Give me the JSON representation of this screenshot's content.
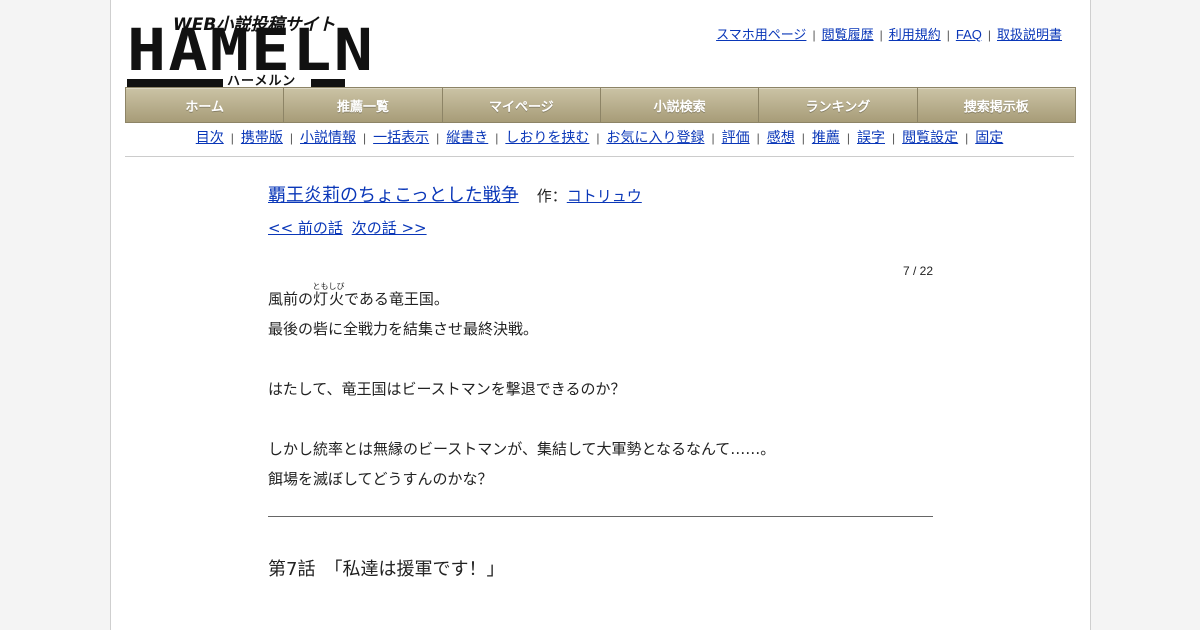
{
  "logo": {
    "tagline": "WEB小説投稿サイト",
    "wordmark": "HAMELN",
    "kana": "ハーメルン"
  },
  "top_links": [
    "スマホ用ページ",
    "閲覧履歴",
    "利用規約",
    "FAQ",
    "取扱説明書"
  ],
  "nav": [
    "ホーム",
    "推薦一覧",
    "マイページ",
    "小説検索",
    "ランキング",
    "捜索掲示板"
  ],
  "sub_nav": [
    "目次",
    "携帯版",
    "小説情報",
    "一括表示",
    "縦書き",
    "しおりを挟む",
    "お気に入り登録",
    "評価",
    "感想",
    "推薦",
    "誤字",
    "閲覧設定",
    "固定"
  ],
  "novel": {
    "title": "覇王炎莉のちょこっとした戦争",
    "author_label": "作：",
    "author": "コトリュウ",
    "prev": "<< 前の話",
    "next": "次の話 >>",
    "count": "7 / 22"
  },
  "foreword": {
    "line1_pre": "風前の",
    "line1_ruby_base": "灯火",
    "line1_ruby_text": "ともしび",
    "line1_post": "である竜王国。",
    "line2": "最後の砦に全戦力を結集させ最終決戦。",
    "line3": "はたして、竜王国はビーストマンを撃退できるのか？",
    "line4": "しかし統率とは無縁のビーストマンが、集結して大軍勢となるなんて……。",
    "line5": "餌場を滅ぼしてどうすんのかな？"
  },
  "chapter": {
    "number": "第7話",
    "title": "「私達は援軍です！」"
  }
}
